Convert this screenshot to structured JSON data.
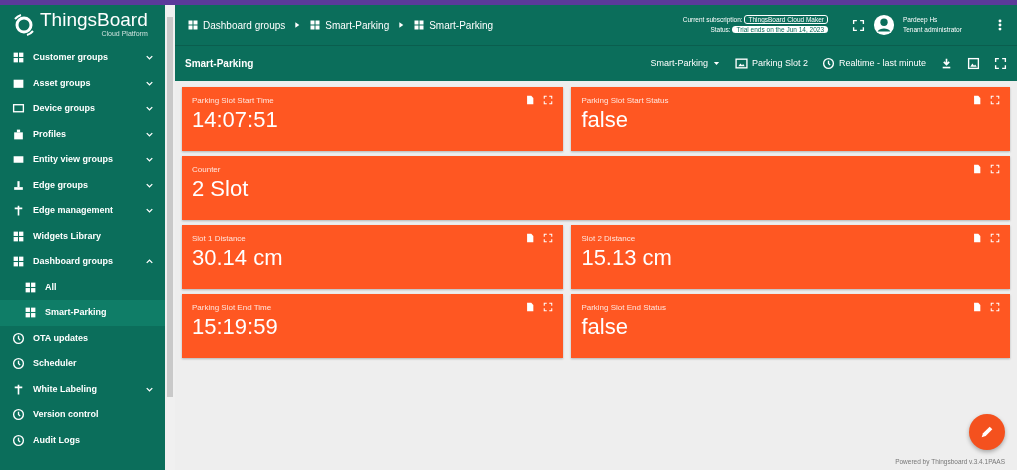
{
  "logo": {
    "name": "ThingsBoard",
    "edition": "Cloud Platform"
  },
  "breadcrumbs": [
    {
      "label": "Dashboard groups"
    },
    {
      "label": "Smart-Parking"
    },
    {
      "label": "Smart-Parking"
    }
  ],
  "subscription": {
    "label": "Current subscription:",
    "plan": "ThingsBoard Cloud Maker",
    "status_label": "Status:",
    "status": "Trial ends on the Jun 14, 2023"
  },
  "user": {
    "name": "Pardeep Hs",
    "role": "Tenant administrator"
  },
  "sidebar": {
    "items": [
      {
        "label": "Customer groups",
        "kind": "group",
        "expanded": false,
        "selected": false
      },
      {
        "label": "Asset groups",
        "kind": "group",
        "expanded": false,
        "selected": false
      },
      {
        "label": "Device groups",
        "kind": "group",
        "expanded": false,
        "selected": false
      },
      {
        "label": "Profiles",
        "kind": "group",
        "expanded": false,
        "selected": false
      },
      {
        "label": "Entity view groups",
        "kind": "group",
        "expanded": false,
        "selected": false
      },
      {
        "label": "Edge groups",
        "kind": "group",
        "expanded": false,
        "selected": false
      },
      {
        "label": "Edge management",
        "kind": "group",
        "expanded": false,
        "selected": false
      },
      {
        "label": "Widgets Library",
        "kind": "link",
        "selected": false
      },
      {
        "label": "Dashboard groups",
        "kind": "group",
        "expanded": true,
        "selected": false,
        "children": [
          {
            "label": "All",
            "selected": false
          },
          {
            "label": "Smart-Parking",
            "selected": true
          }
        ]
      },
      {
        "label": "OTA updates",
        "kind": "link",
        "selected": false
      },
      {
        "label": "Scheduler",
        "kind": "link",
        "selected": false
      },
      {
        "label": "White Labeling",
        "kind": "group",
        "expanded": false,
        "selected": false
      },
      {
        "label": "Version control",
        "kind": "link",
        "selected": false
      },
      {
        "label": "Audit Logs",
        "kind": "link",
        "selected": false
      }
    ]
  },
  "dashboard": {
    "title": "Smart-Parking",
    "state_select": "Smart-Parking",
    "entity": "Parking Slot 2",
    "timewindow": "Realtime - last minute"
  },
  "widgets": [
    {
      "title": "Parking Slot Start Time",
      "value": "14:07:51",
      "wide": false
    },
    {
      "title": "Parking Slot Start Status",
      "value": "false",
      "wide": false
    },
    {
      "title": "Counter",
      "value": "2 Slot",
      "wide": true
    },
    {
      "title": "Slot 1 Distance",
      "value": "30.14 cm",
      "wide": false
    },
    {
      "title": "Slot 2 Distance",
      "value": "15.13 cm",
      "wide": false
    },
    {
      "title": "Parking Slot End Time",
      "value": "15:19:59",
      "wide": false
    },
    {
      "title": "Parking Slot End Status",
      "value": "false",
      "wide": false
    }
  ],
  "footer": "Powered by Thingsboard v.3.4.1PAAS"
}
